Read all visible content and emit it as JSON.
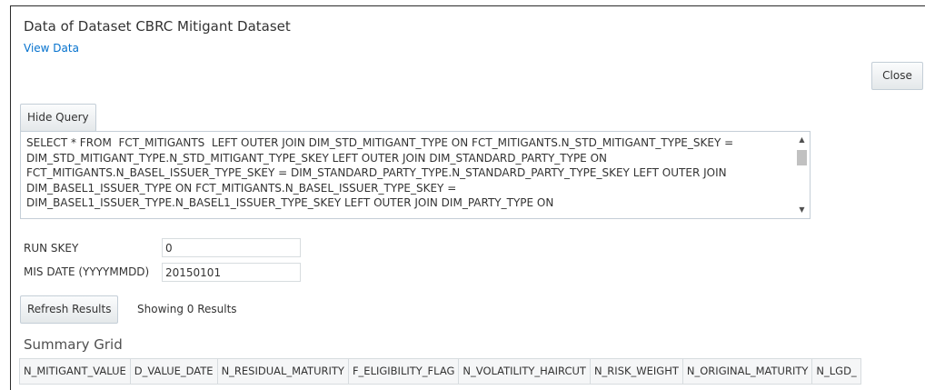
{
  "header": {
    "title": "Data of Dataset CBRC Mitigant Dataset",
    "view_data_link": "View Data"
  },
  "toolbar": {
    "close_label": "Close",
    "hide_query_label": "Hide Query"
  },
  "query": {
    "text": "SELECT * FROM  FCT_MITIGANTS  LEFT OUTER JOIN DIM_STD_MITIGANT_TYPE ON FCT_MITIGANTS.N_STD_MITIGANT_TYPE_SKEY = DIM_STD_MITIGANT_TYPE.N_STD_MITIGANT_TYPE_SKEY LEFT OUTER JOIN DIM_STANDARD_PARTY_TYPE ON FCT_MITIGANTS.N_BASEL_ISSUER_TYPE_SKEY = DIM_STANDARD_PARTY_TYPE.N_STANDARD_PARTY_TYPE_SKEY LEFT OUTER JOIN DIM_BASEL1_ISSUER_TYPE ON FCT_MITIGANTS.N_BASEL_ISSUER_TYPE_SKEY = DIM_BASEL1_ISSUER_TYPE.N_BASEL1_ISSUER_TYPE_SKEY LEFT OUTER JOIN DIM_PARTY_TYPE ON",
    "lines": [
      "SELECT * FROM  FCT_MITIGANTS  LEFT OUTER JOIN DIM_STD_MITIGANT_TYPE ON FCT_MITIGANTS.N_STD_MITIGANT_TYPE_SKEY =",
      "DIM_STD_MITIGANT_TYPE.N_STD_MITIGANT_TYPE_SKEY LEFT OUTER JOIN DIM_STANDARD_PARTY_TYPE ON",
      "FCT_MITIGANTS.N_BASEL_ISSUER_TYPE_SKEY = DIM_STANDARD_PARTY_TYPE.N_STANDARD_PARTY_TYPE_SKEY LEFT OUTER JOIN",
      "DIM_BASEL1_ISSUER_TYPE ON FCT_MITIGANTS.N_BASEL_ISSUER_TYPE_SKEY =",
      "DIM_BASEL1_ISSUER_TYPE.N_BASEL1_ISSUER_TYPE_SKEY LEFT OUTER JOIN DIM_PARTY_TYPE ON"
    ],
    "scroll_up_icon": "triangle-up",
    "scroll_down_icon": "triangle-down"
  },
  "params": {
    "run_skey_label": "RUN SKEY",
    "run_skey_value": "0",
    "mis_date_label": "MIS DATE (YYYYMMDD)",
    "mis_date_value": "20150101"
  },
  "results": {
    "refresh_label": "Refresh Results",
    "showing_text": "Showing 0 Results"
  },
  "grid": {
    "title": "Summary Grid",
    "columns": [
      "N_MITIGANT_VALUE",
      "D_VALUE_DATE",
      "N_RESIDUAL_MATURITY",
      "F_ELIGIBILITY_FLAG",
      "N_VOLATILITY_HAIRCUT",
      "N_RISK_WEIGHT",
      "N_ORIGINAL_MATURITY",
      "N_LGD_"
    ]
  },
  "colors": {
    "link": "#0572ce",
    "border": "#c4ced7",
    "grid_header_bg": "#f5f6f7"
  }
}
